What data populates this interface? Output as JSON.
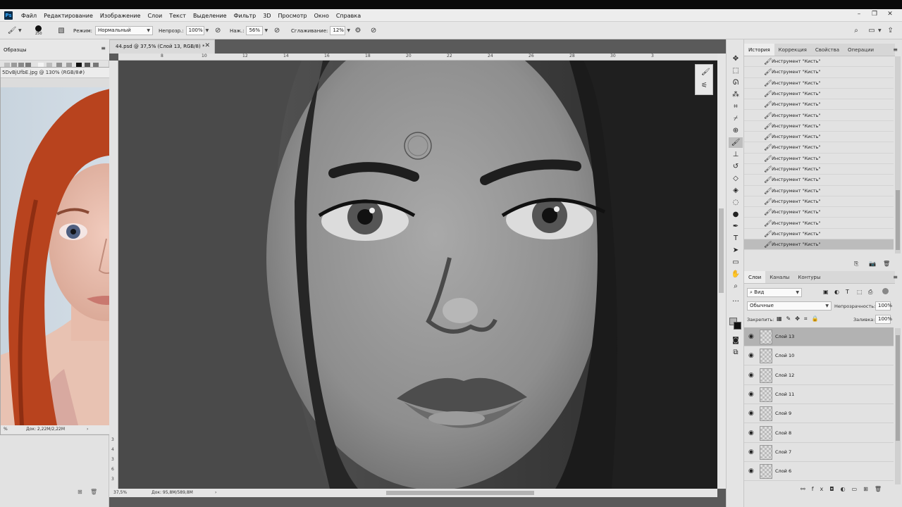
{
  "app": {
    "icon": "Ps"
  },
  "menu": [
    "Файл",
    "Редактирование",
    "Изображение",
    "Слои",
    "Текст",
    "Выделение",
    "Фильтр",
    "3D",
    "Просмотр",
    "Окно",
    "Справка"
  ],
  "window_controls": [
    "–",
    "❐",
    "✕"
  ],
  "options": {
    "mode_label": "Режим:",
    "mode_value": "Нормальный",
    "opacity_label": "Непрозр.:",
    "opacity_value": "100%",
    "pressure_label": "Наж.:",
    "pressure_value": "56%",
    "smoothing_label": "Сглаживание:",
    "smoothing_value": "12%",
    "brush_size": "250"
  },
  "left_panel": {
    "swatches_tab": "Образцы"
  },
  "reference_window": {
    "title": "5DvBjUfbE.jpg @ 130% (RGB/8#)",
    "status": "Док: 2,22M/2,22M"
  },
  "document": {
    "tab_title": "44.psd @ 37,5% (Слой 13, RGB/8) *",
    "zoom": "37,5%",
    "status": "Док: 95,8M/589,8M",
    "ruler_numbers": [
      "8",
      "10",
      "12",
      "14",
      "16",
      "18",
      "20",
      "22",
      "24",
      "26",
      "28",
      "30",
      "3"
    ],
    "vruler_numbers": [
      "3",
      "4",
      "3",
      "6",
      "3"
    ]
  },
  "history_panel": {
    "tabs": [
      "История",
      "Коррекция",
      "Свойства",
      "Операции"
    ],
    "items": [
      "Инструмент \"Кисть\"",
      "Инструмент \"Кисть\"",
      "Инструмент \"Кисть\"",
      "Инструмент \"Кисть\"",
      "Инструмент \"Кисть\"",
      "Инструмент \"Кисть\"",
      "Инструмент \"Кисть\"",
      "Инструмент \"Кисть\"",
      "Инструмент \"Кисть\"",
      "Инструмент \"Кисть\"",
      "Инструмент \"Кисть\"",
      "Инструмент \"Кисть\"",
      "Инструмент \"Кисть\"",
      "Инструмент \"Кисть\"",
      "Инструмент \"Кисть\"",
      "Инструмент \"Кисть\"",
      "Инструмент \"Кисть\"",
      "Инструмент \"Кисть\""
    ]
  },
  "layers_panel": {
    "tabs": [
      "Слои",
      "Каналы",
      "Контуры"
    ],
    "filter_kind": "Вид",
    "blend_mode": "Обычные",
    "opacity_label": "Непрозрачность:",
    "opacity_value": "100%",
    "lock_label": "Закрепить:",
    "fill_label": "Заливка:",
    "fill_value": "100%",
    "layers": [
      "Слой 13",
      "Слой 10",
      "Слой 12",
      "Слой 11",
      "Слой 9",
      "Слой 8",
      "Слой 7",
      "Слой 6"
    ]
  },
  "colors": {
    "accent_selected": "#b2b2b2",
    "panel_bg": "#e2e2e2",
    "canvas_bg": "#3b3b3b"
  }
}
